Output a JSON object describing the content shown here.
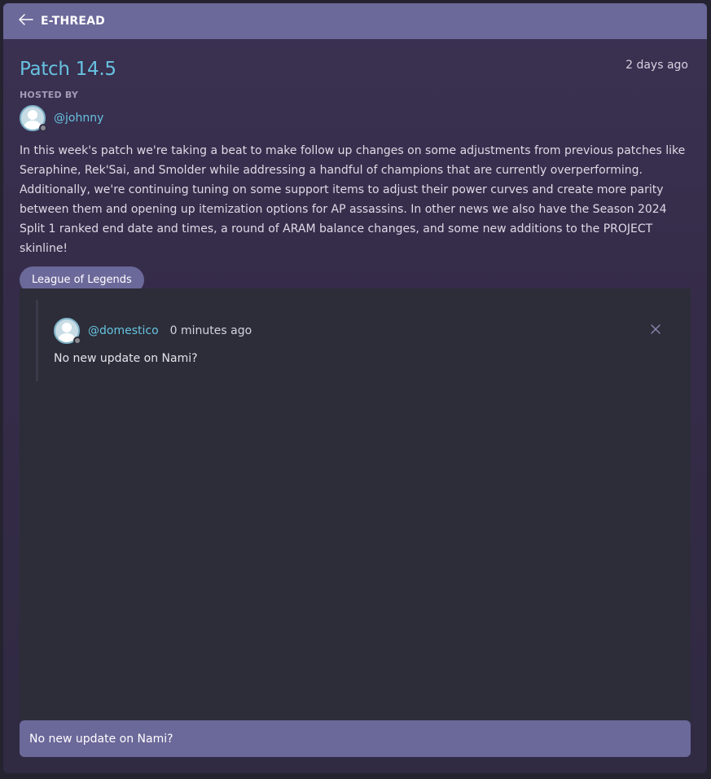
{
  "header": {
    "title": "E-THREAD",
    "back_icon": "arrow-left-icon"
  },
  "post": {
    "title": "Patch 14.5",
    "time": "2 days ago",
    "hosted_label": "HOSTED BY",
    "host": "@johnny",
    "body": "In this week's patch we're taking a beat to make follow up changes on some adjustments from previous patches like Seraphine, Rek'Sai, and Smolder while addressing a handful of champions that are currently overperforming. Additionally, we're continuing tuning on some support items to adjust their power curves and create more parity between them and opening up itemization options for AP assassins. In other news we also have the Season 2024 Split 1 ranked end date and times, a round of ARAM balance changes, and some new additions to the PROJECT skinline!",
    "tag": "League of Legends"
  },
  "comments": [
    {
      "user": "@domestico",
      "time": "0 minutes ago",
      "text": "No new update on Nami?"
    }
  ],
  "reply": {
    "value": "No new update on Nami?"
  },
  "colors": {
    "accent": "#6b689a",
    "link": "#67c2e0",
    "panel": "#2c2d38",
    "background": "#352c49"
  }
}
